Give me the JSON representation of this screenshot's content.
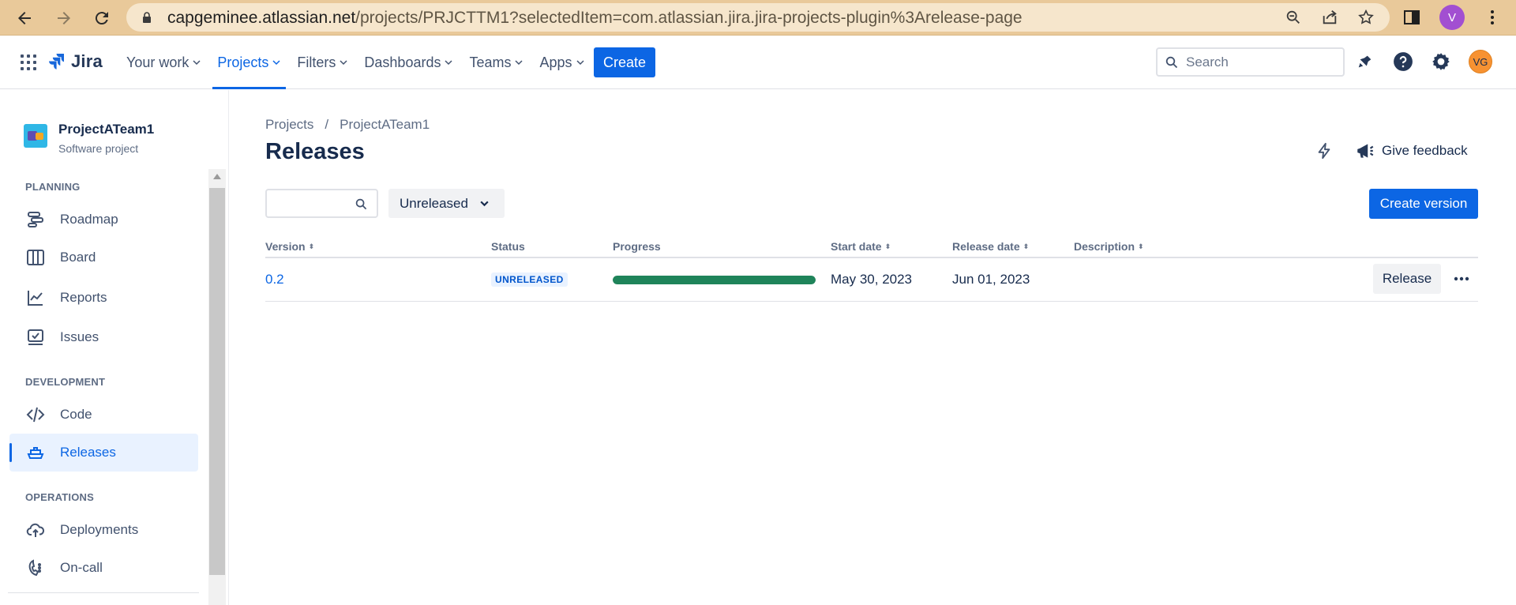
{
  "browser": {
    "url_host": "capgeminee.atlassian.net",
    "url_path": "/projects/PRJCTTM1?selectedItem=com.atlassian.jira.jira-projects-plugin%3Arelease-page",
    "profile_initial": "V"
  },
  "topnav": {
    "logo_text": "Jira",
    "items": [
      {
        "label": "Your work",
        "active": false
      },
      {
        "label": "Projects",
        "active": true
      },
      {
        "label": "Filters",
        "active": false
      },
      {
        "label": "Dashboards",
        "active": false
      },
      {
        "label": "Teams",
        "active": false
      },
      {
        "label": "Apps",
        "active": false
      }
    ],
    "create_label": "Create",
    "search_placeholder": "Search",
    "avatar_initials": "VG",
    "icons": [
      "notifications-icon",
      "help-icon",
      "settings-icon"
    ]
  },
  "sidebar": {
    "project_name": "ProjectATeam1",
    "project_type": "Software project",
    "sections": [
      {
        "title": "PLANNING",
        "items": [
          {
            "label": "Roadmap",
            "icon": "roadmap-icon"
          },
          {
            "label": "Board",
            "icon": "board-icon"
          },
          {
            "label": "Reports",
            "icon": "reports-icon"
          },
          {
            "label": "Issues",
            "icon": "issues-icon"
          }
        ]
      },
      {
        "title": "DEVELOPMENT",
        "items": [
          {
            "label": "Code",
            "icon": "code-icon"
          },
          {
            "label": "Releases",
            "icon": "releases-icon",
            "active": true
          }
        ]
      },
      {
        "title": "OPERATIONS",
        "items": [
          {
            "label": "Deployments",
            "icon": "deployments-icon"
          },
          {
            "label": "On-call",
            "icon": "on-call-icon"
          }
        ]
      }
    ]
  },
  "main": {
    "breadcrumb": [
      "Projects",
      "/",
      "ProjectATeam1"
    ],
    "title": "Releases",
    "feedback_label": "Give feedback",
    "status_filter": "Unreleased",
    "create_version_label": "Create version",
    "columns": [
      "Version",
      "Status",
      "Progress",
      "Start date",
      "Release date",
      "Description"
    ],
    "rows": [
      {
        "version": "0.2",
        "status": "UNRELEASED",
        "progress": 1.0,
        "start_date": "May 30, 2023",
        "release_date": "Jun 01, 2023",
        "description": "",
        "release_label": "Release"
      }
    ],
    "colors": {
      "accent": "#0c66e4",
      "progress_fill": "#1f845a",
      "active_bg": "#e9f2ff"
    }
  }
}
